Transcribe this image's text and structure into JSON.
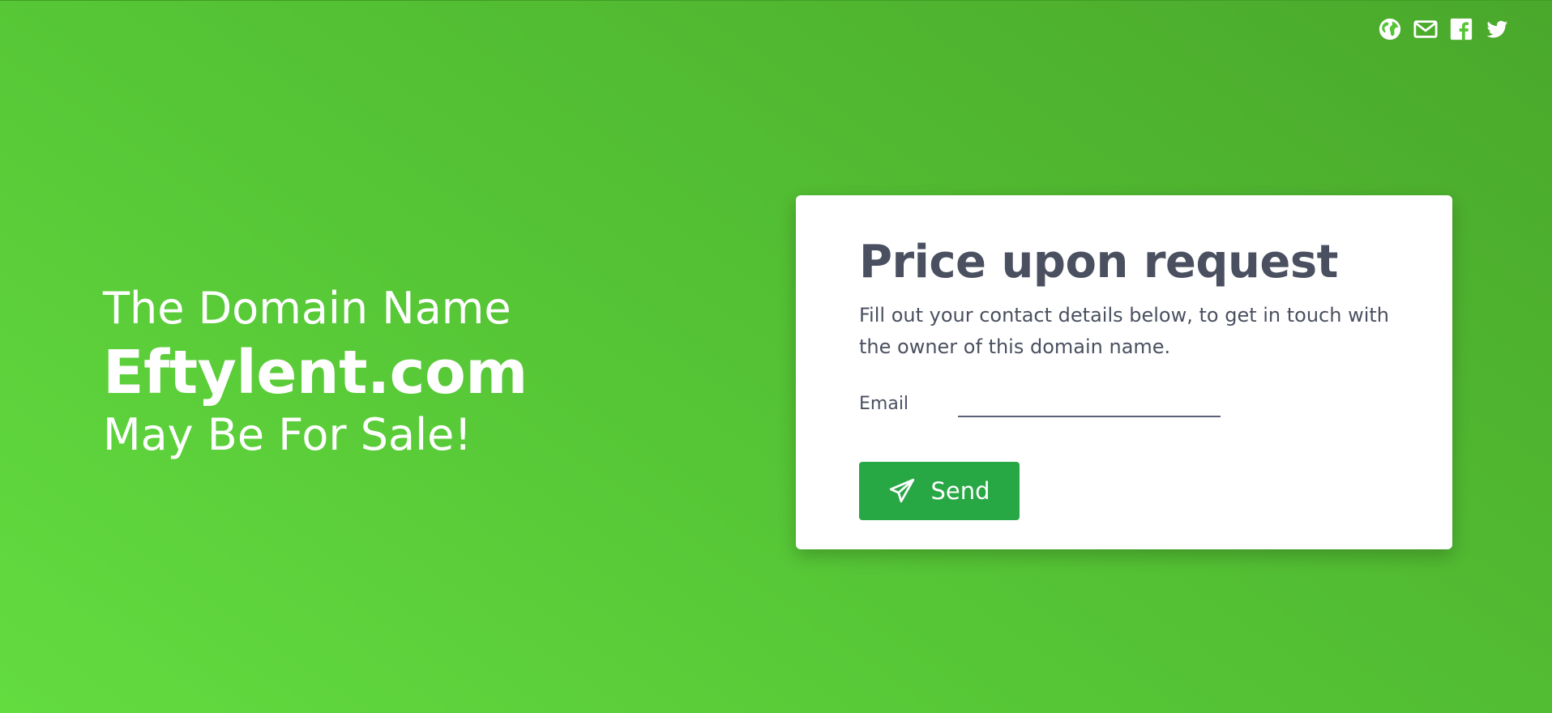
{
  "social": {
    "icons": [
      "globe-icon",
      "envelope-icon",
      "facebook-icon",
      "twitter-icon"
    ],
    "color": "#ffffff"
  },
  "hero": {
    "line1": "The Domain Name",
    "domain": "Eftylent.com",
    "line3": "May Be For Sale!"
  },
  "card": {
    "title": "Price upon request",
    "description": "Fill out your contact details below, to get in touch with the owner of this domain name.",
    "email_label": "Email",
    "email_value": "",
    "email_placeholder": "",
    "send_label": "Send",
    "send_icon": "paper-plane-icon"
  },
  "colors": {
    "background_start": "#63dc40",
    "background_end": "#4aa82b",
    "button": "#28a745",
    "text_dark": "#4a5060"
  }
}
